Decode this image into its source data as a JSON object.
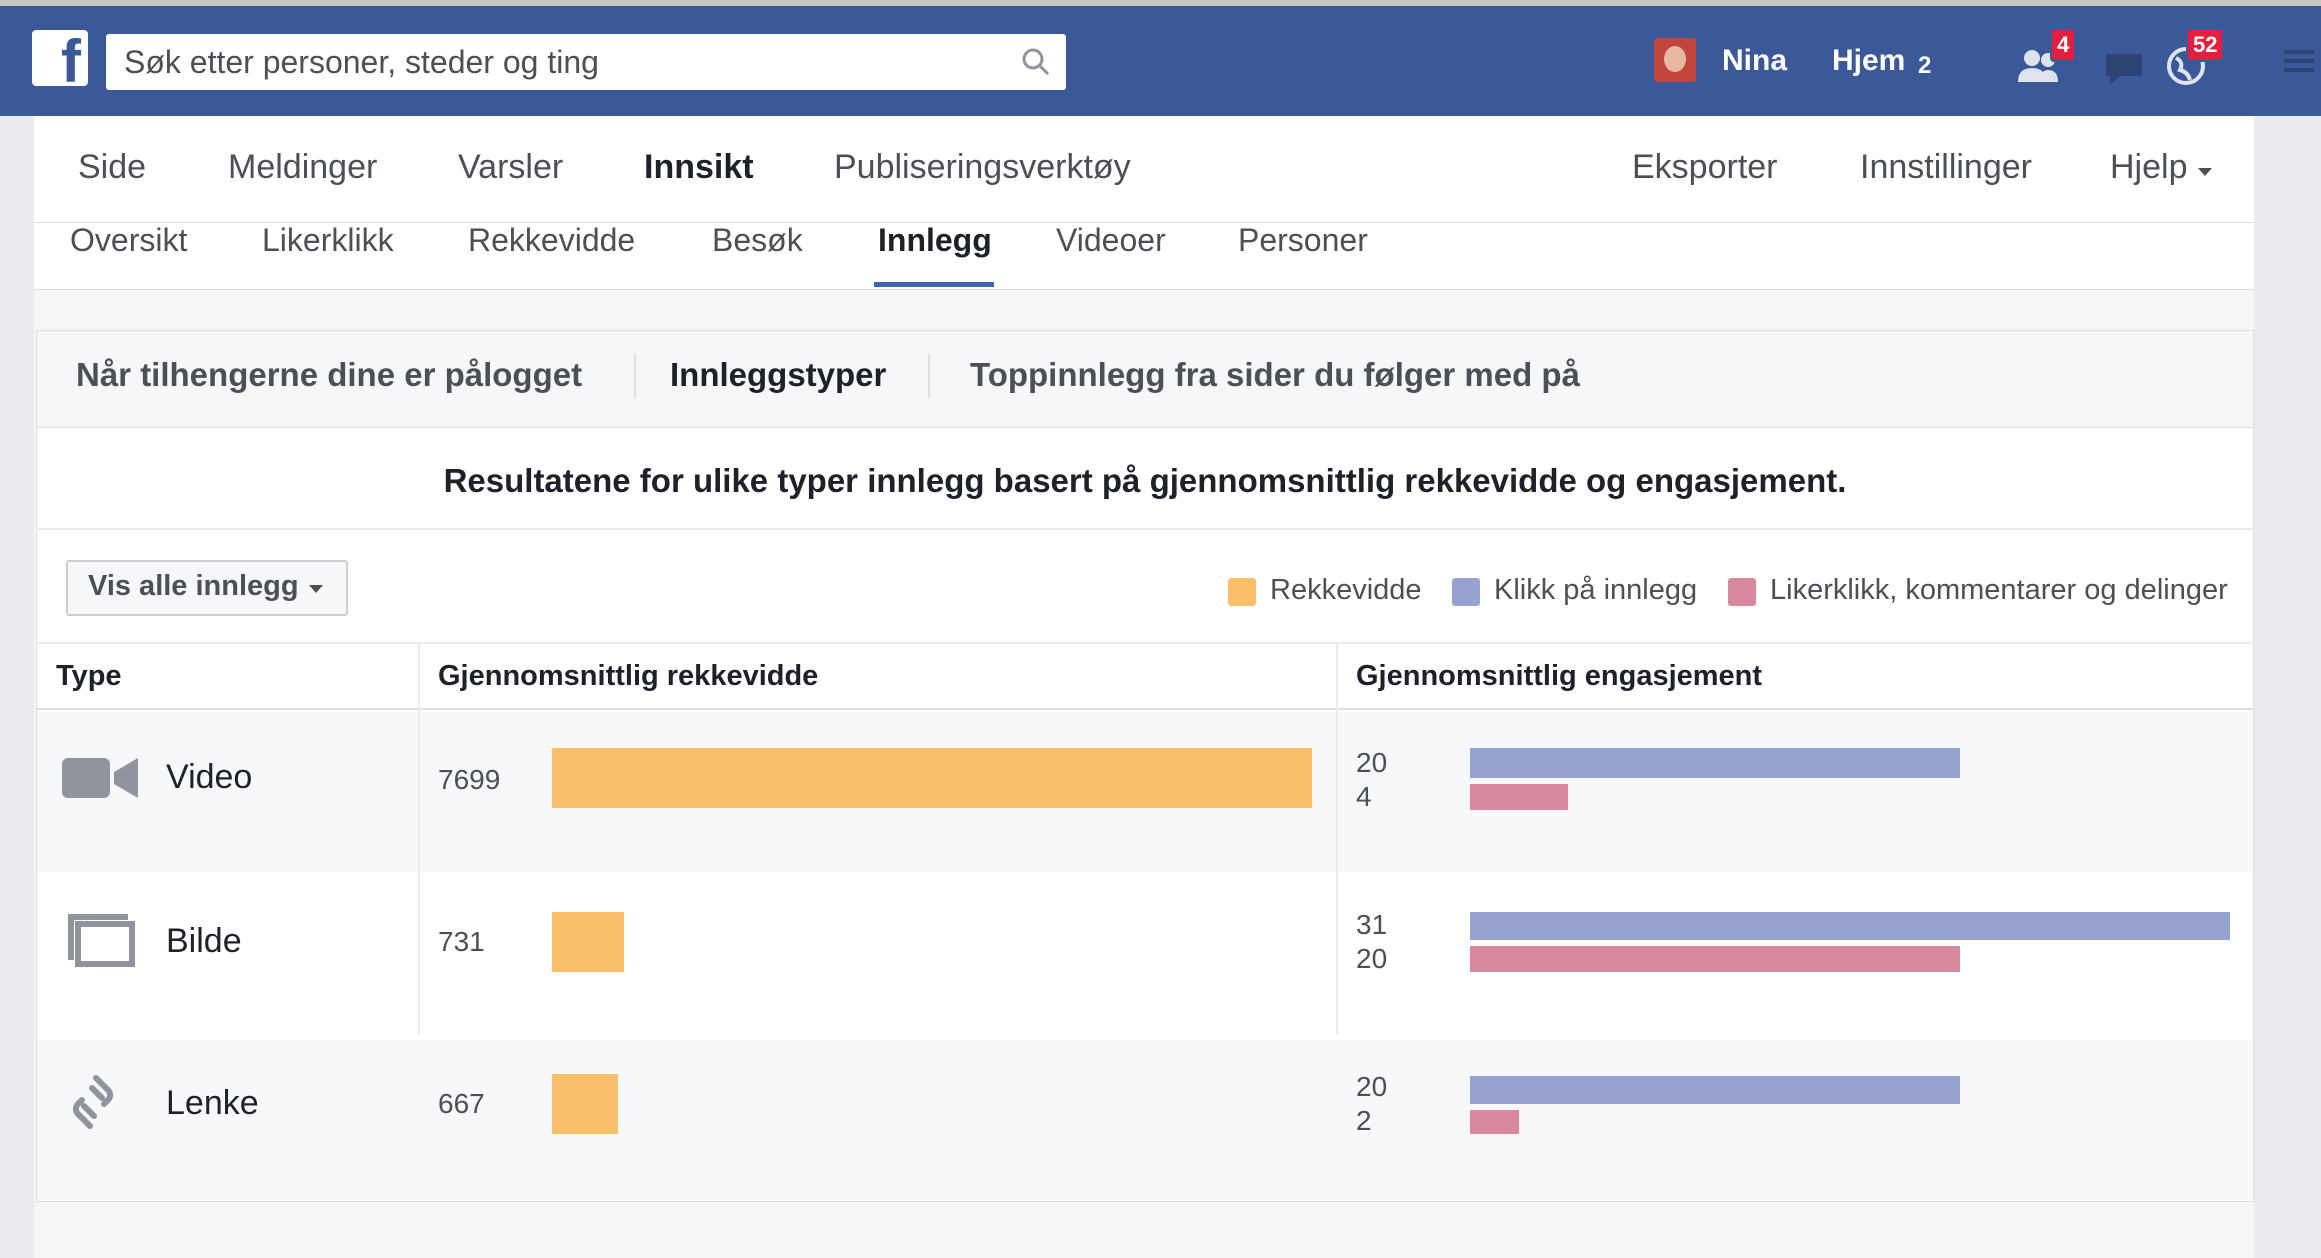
{
  "topbar": {
    "search_placeholder": "Søk etter personer, steder og ting",
    "user_name": "Nina",
    "home_label": "Hjem",
    "home_count": "2",
    "friend_requests_badge": "4",
    "notifications_badge": "52",
    "icons": [
      "facebook-logo",
      "search-icon",
      "friends-icon",
      "messages-icon",
      "globe-icon"
    ]
  },
  "nav": {
    "items": [
      "Side",
      "Meldinger",
      "Varsler",
      "Innsikt",
      "Publiseringsverktøy"
    ],
    "active": "Innsikt",
    "right_items": [
      "Eksporter",
      "Innstillinger",
      "Hjelp"
    ]
  },
  "subnav": {
    "items": [
      "Oversikt",
      "Likerklikk",
      "Rekkevidde",
      "Besøk",
      "Innlegg",
      "Videoer",
      "Personer"
    ],
    "active": "Innlegg"
  },
  "card": {
    "tabs": [
      "Når tilhengerne dine er pålogget",
      "Innleggstyper",
      "Toppinnlegg fra sider du følger med på"
    ],
    "active_tab": "Innleggstyper",
    "description": "Resultatene for ulike typer innlegg basert på gjennomsnittlig rekkevidde og engasjement.",
    "filter_label": "Vis alle innlegg",
    "legend": [
      "Rekkevidde",
      "Klikk på innlegg",
      "Likerklikk, kommentarer og delinger"
    ],
    "colors": {
      "reach": "#fbbf6b",
      "clicks": "#97a3cf",
      "engagement": "#d9899e"
    }
  },
  "table": {
    "headers": [
      "Type",
      "Gjennomsnittlig rekkevidde",
      "Gjennomsnittlig engasjement"
    ],
    "rows": [
      {
        "type": "Video",
        "icon": "video-icon",
        "reach": 7699,
        "reach_label": "7699",
        "clicks": 20,
        "clicks_label": "20",
        "engagement": 4,
        "engagement_label": "4"
      },
      {
        "type": "Bilde",
        "icon": "photo-icon",
        "reach": 731,
        "reach_label": "731",
        "clicks": 31,
        "clicks_label": "31",
        "engagement": 20,
        "engagement_label": "20"
      },
      {
        "type": "Lenke",
        "icon": "link-icon",
        "reach": 667,
        "reach_label": "667",
        "clicks": 20,
        "clicks_label": "20",
        "engagement": 2,
        "engagement_label": "2"
      }
    ]
  }
}
